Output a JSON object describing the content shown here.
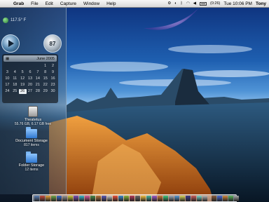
{
  "menubar": {
    "apple": "",
    "menus": [
      "Grab",
      "File",
      "Edit",
      "Capture",
      "Window",
      "Help"
    ],
    "battery_time": "(0:26)",
    "clock": "Tue 10:06 PM",
    "user": "Tony"
  },
  "widgets": {
    "weather": {
      "temp": "117.5° F"
    },
    "gauge": {
      "value": "87"
    },
    "calendar": {
      "month_label": "June 2005",
      "days": [
        "",
        "",
        "",
        "",
        "",
        "1",
        "2",
        "3",
        "4",
        "5",
        "6",
        "7",
        "8",
        "9",
        "10",
        "11",
        "12",
        "13",
        "14",
        "15",
        "16",
        "17",
        "18",
        "19",
        "20",
        "21",
        "22",
        "23",
        "24",
        "25",
        "26",
        "27",
        "28",
        "29",
        "30"
      ],
      "today": "26"
    }
  },
  "desktop": {
    "volumes": [
      {
        "name": "Theatetus",
        "detail": "55.76 GB, 6.17 GB free",
        "icon": "hard-drive-icon"
      },
      {
        "name": "Document Storage",
        "detail": "817 items",
        "icon": "folder-icon"
      },
      {
        "name": "Folder Storage",
        "detail": "12 items",
        "icon": "folder-icon"
      }
    ]
  },
  "colors": {
    "sky_top": "#0d2f7a",
    "horizon": "#8fc0ec",
    "terrain_orange": "#d9781c",
    "terrain_blue": "#1b3550"
  },
  "dock": {
    "icon_colors": [
      "#5a7fb5",
      "#c94b3b",
      "#e9a23b",
      "#6fa84a",
      "#3b6fc9",
      "#9a9a9a",
      "#c9c93b",
      "#7b4fb5",
      "#3bb5c9",
      "#d55b9a",
      "#4a8a4a",
      "#b5733b",
      "#5a5ab5",
      "#c9c9c9",
      "#e9503b",
      "#3b8ac9",
      "#8ab53b",
      "#b53b5a",
      "#6a6a6a",
      "#f0c040",
      "#4ab5a0",
      "#a05ac9",
      "#c97a3b",
      "#3bc97a",
      "#9aa9b9",
      "#5a9ad5",
      "#d5d55a",
      "#3b3b8a",
      "#c95a5a",
      "#7ad5c9",
      "#b5b5b5",
      "#8a5a3b",
      "#4a6ad5",
      "#d58a3b",
      "#5ab55a",
      "#aaaaaa"
    ]
  }
}
